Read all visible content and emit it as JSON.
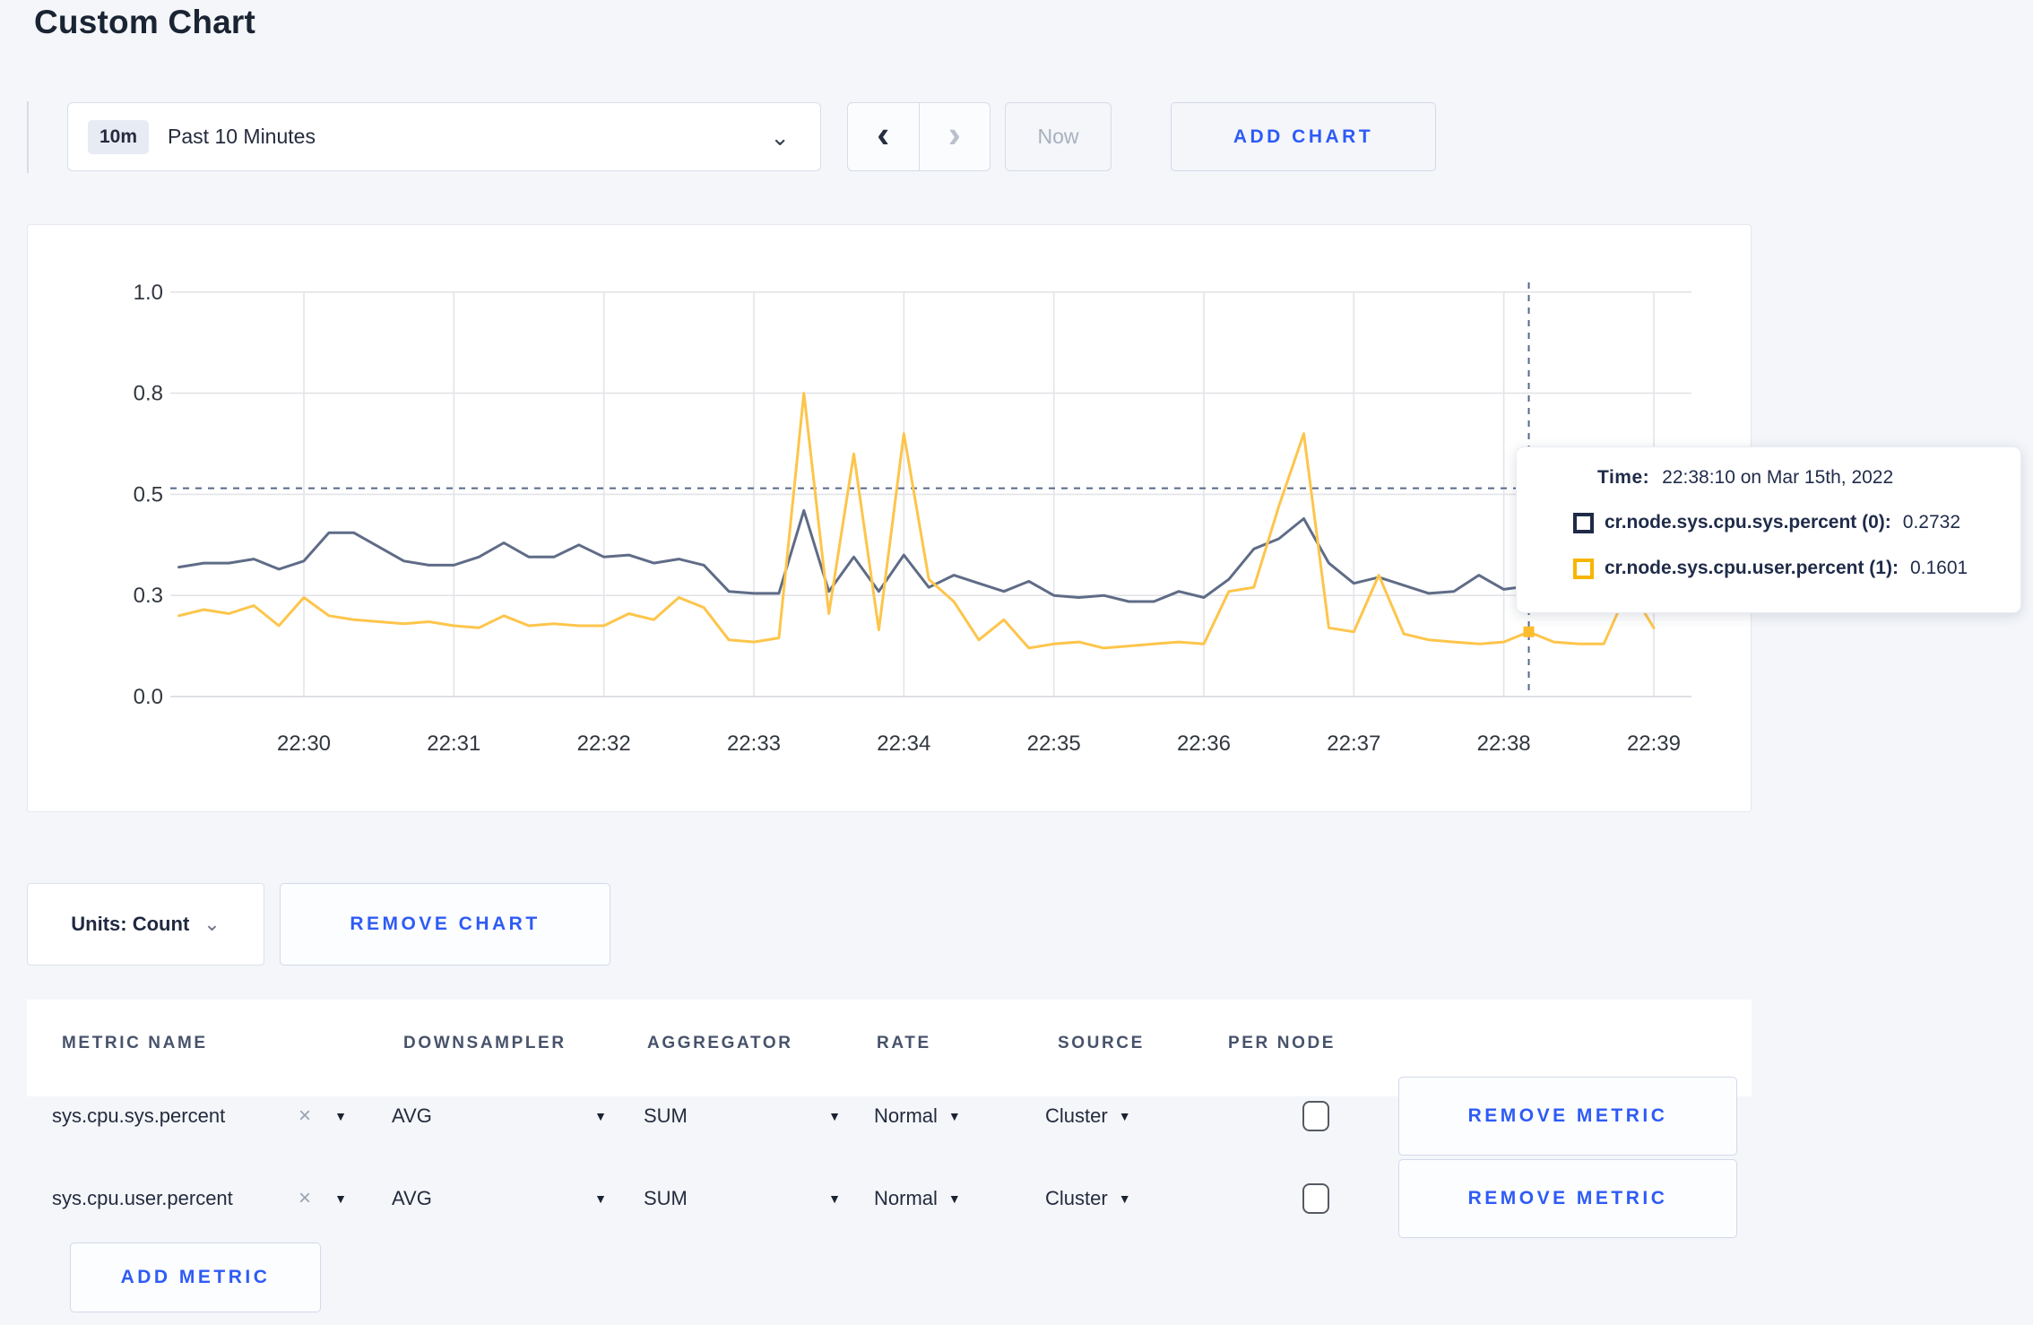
{
  "page": {
    "title": "Custom Chart"
  },
  "icons": {
    "chevron_down": "⌄",
    "chevron_left": "‹",
    "chevron_right": "›",
    "caret_down": "▼",
    "close_x": "×"
  },
  "toolbar": {
    "time_badge": "10m",
    "time_label": "Past 10 Minutes",
    "now_label": "Now",
    "add_chart_label": "ADD CHART"
  },
  "tooltip": {
    "time_label": "Time:",
    "time_value": "22:38:10 on Mar 15th, 2022",
    "rows": [
      {
        "label": "cr.node.sys.cpu.sys.percent (0):",
        "value": "0.2732",
        "color": "#1f2a48"
      },
      {
        "label": "cr.node.sys.cpu.user.percent (1):",
        "value": "0.1601",
        "color": "#f7b500"
      }
    ]
  },
  "chart_data": {
    "type": "line",
    "title": "",
    "xlabel": "",
    "ylabel": "",
    "ylim": [
      0,
      1
    ],
    "grid": true,
    "start_time": "22:29:10",
    "interval_seconds": 10,
    "x_ticks": [
      "22:30",
      "22:31",
      "22:32",
      "22:33",
      "22:34",
      "22:35",
      "22:36",
      "22:37",
      "22:38",
      "22:39"
    ],
    "y_ticks": [
      {
        "value": 0.0,
        "label": "0.0"
      },
      {
        "value": 0.25,
        "label": "0.3"
      },
      {
        "value": 0.5,
        "label": "0.5"
      },
      {
        "value": 0.75,
        "label": "0.8"
      },
      {
        "value": 1.0,
        "label": "1.0"
      }
    ],
    "crosshair": {
      "index": 54,
      "time": "22:38:10",
      "hline_value": 0.515
    },
    "series": [
      {
        "name": "cr.node.sys.cpu.sys.percent",
        "color": "#5f6c87",
        "dot_color": "#26324f",
        "values": [
          0.32,
          0.33,
          0.33,
          0.34,
          0.315,
          0.335,
          0.405,
          0.405,
          0.37,
          0.335,
          0.325,
          0.325,
          0.345,
          0.38,
          0.345,
          0.345,
          0.375,
          0.345,
          0.35,
          0.33,
          0.34,
          0.325,
          0.26,
          0.255,
          0.255,
          0.46,
          0.26,
          0.345,
          0.26,
          0.35,
          0.27,
          0.3,
          0.28,
          0.26,
          0.285,
          0.25,
          0.245,
          0.25,
          0.235,
          0.235,
          0.26,
          0.245,
          0.29,
          0.365,
          0.39,
          0.44,
          0.33,
          0.28,
          0.295,
          0.275,
          0.255,
          0.26,
          0.3,
          0.265,
          0.2732,
          0.28,
          0.29,
          0.3,
          0.3,
          0.295
        ]
      },
      {
        "name": "cr.node.sys.cpu.user.percent",
        "color": "#fdc54b",
        "dot_color": "#fdbb2e",
        "values": [
          0.2,
          0.215,
          0.205,
          0.225,
          0.175,
          0.245,
          0.2,
          0.19,
          0.185,
          0.18,
          0.185,
          0.175,
          0.17,
          0.2,
          0.175,
          0.18,
          0.175,
          0.175,
          0.205,
          0.19,
          0.245,
          0.22,
          0.14,
          0.135,
          0.145,
          0.75,
          0.205,
          0.6,
          0.165,
          0.65,
          0.29,
          0.235,
          0.14,
          0.19,
          0.12,
          0.13,
          0.135,
          0.12,
          0.125,
          0.13,
          0.135,
          0.13,
          0.26,
          0.27,
          0.47,
          0.65,
          0.17,
          0.16,
          0.3,
          0.155,
          0.14,
          0.135,
          0.13,
          0.135,
          0.1601,
          0.135,
          0.13,
          0.13,
          0.27,
          0.17
        ]
      }
    ]
  },
  "controls": {
    "units_label": "Units: Count",
    "remove_chart_label": "REMOVE CHART",
    "add_metric_label": "ADD METRIC"
  },
  "metrics_table": {
    "headers": [
      "METRIC NAME",
      "DOWNSAMPLER",
      "AGGREGATOR",
      "RATE",
      "SOURCE",
      "PER NODE"
    ],
    "rows": [
      {
        "metric": "sys.cpu.sys.percent",
        "downsampler": "AVG",
        "aggregator": "SUM",
        "rate": "Normal",
        "source": "Cluster",
        "per_node_checked": false,
        "remove_label": "REMOVE METRIC"
      },
      {
        "metric": "sys.cpu.user.percent",
        "downsampler": "AVG",
        "aggregator": "SUM",
        "rate": "Normal",
        "source": "Cluster",
        "per_node_checked": false,
        "remove_label": "REMOVE METRIC"
      }
    ]
  }
}
